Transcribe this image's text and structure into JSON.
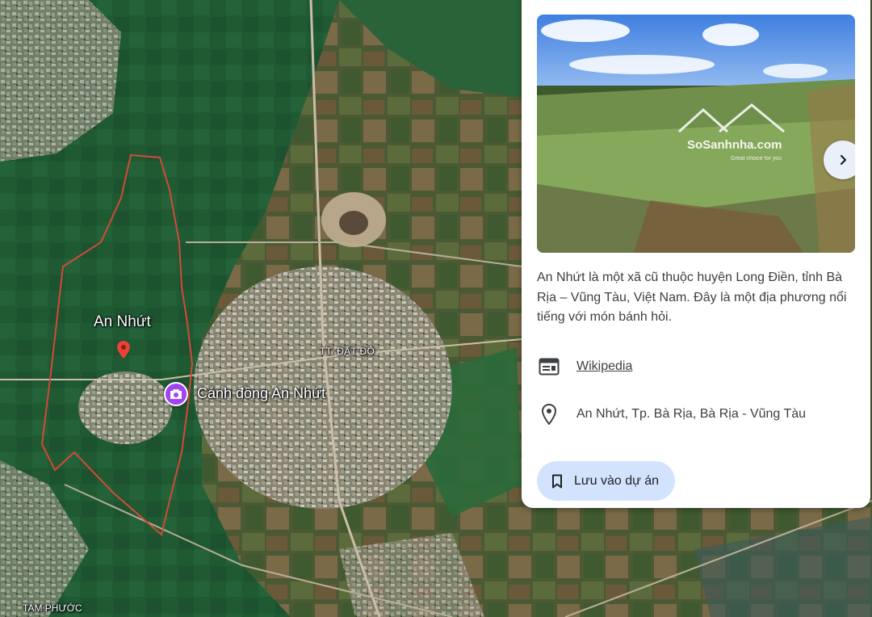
{
  "map": {
    "labels": {
      "commune": "An Nhứt",
      "town": "TT. ĐẤT ĐỎ",
      "place": "Cánh đồng An Nhứt",
      "tam_phuoc": "TAM PHƯỚC"
    },
    "boundary_color": "#d24a3a",
    "pin_color": "#ea4335",
    "photo_marker_color": "#a142f4"
  },
  "panel": {
    "photo": {
      "watermark_name": "SoSanhnha.com",
      "watermark_tagline": "Great choice for you"
    },
    "description": "An Nhứt là một xã cũ thuộc huyện Long Điền, tỉnh Bà Rịa – Vũng Tàu, Việt Nam. Đây là một địa phương nổi tiếng với món bánh hỏi.",
    "wiki_label": "Wikipedia",
    "address": "An Nhứt, Tp. Bà Rịa, Bà Rịa - Vũng Tàu",
    "save_label": "Lưu vào dự án",
    "icons": {
      "wiki": "web-article-icon",
      "address": "location-pin-icon",
      "save": "bookmark-icon",
      "next": "chevron-right-icon"
    },
    "accent": "#1a5fb4",
    "save_bg": "#d3e3fd"
  }
}
